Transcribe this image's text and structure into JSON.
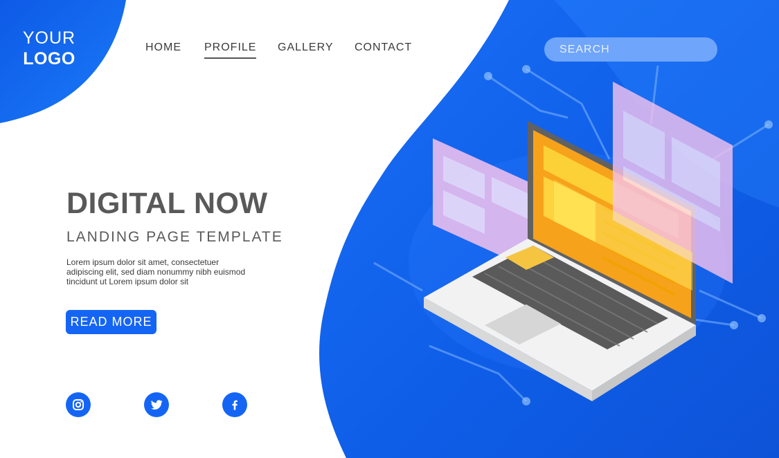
{
  "logo": {
    "line1": "YOUR",
    "line2": "LOGO"
  },
  "nav": {
    "items": [
      {
        "label": "HOME",
        "active": false
      },
      {
        "label": "PROFILE",
        "active": true
      },
      {
        "label": "GALLERY",
        "active": false
      },
      {
        "label": "CONTACT",
        "active": false
      }
    ]
  },
  "search": {
    "placeholder": "SEARCH"
  },
  "hero": {
    "title": "DIGITAL NOW",
    "subtitle": "LANDING PAGE TEMPLATE",
    "description": "Lorem ipsum dolor sit amet, consectetuer adipiscing elit, sed diam nonummy nibh euismod tincidunt ut Lorem ipsum dolor sit",
    "cta_label": "READ MORE"
  },
  "social": {
    "icons": [
      "instagram-icon",
      "twitter-icon",
      "facebook-icon"
    ]
  },
  "colors": {
    "accent": "#1565f5",
    "hero_blue": "#0f5ee8",
    "text_dark": "#595959",
    "screen_orange": "#f7a21b",
    "panel_pink": "#f4b8e6"
  }
}
